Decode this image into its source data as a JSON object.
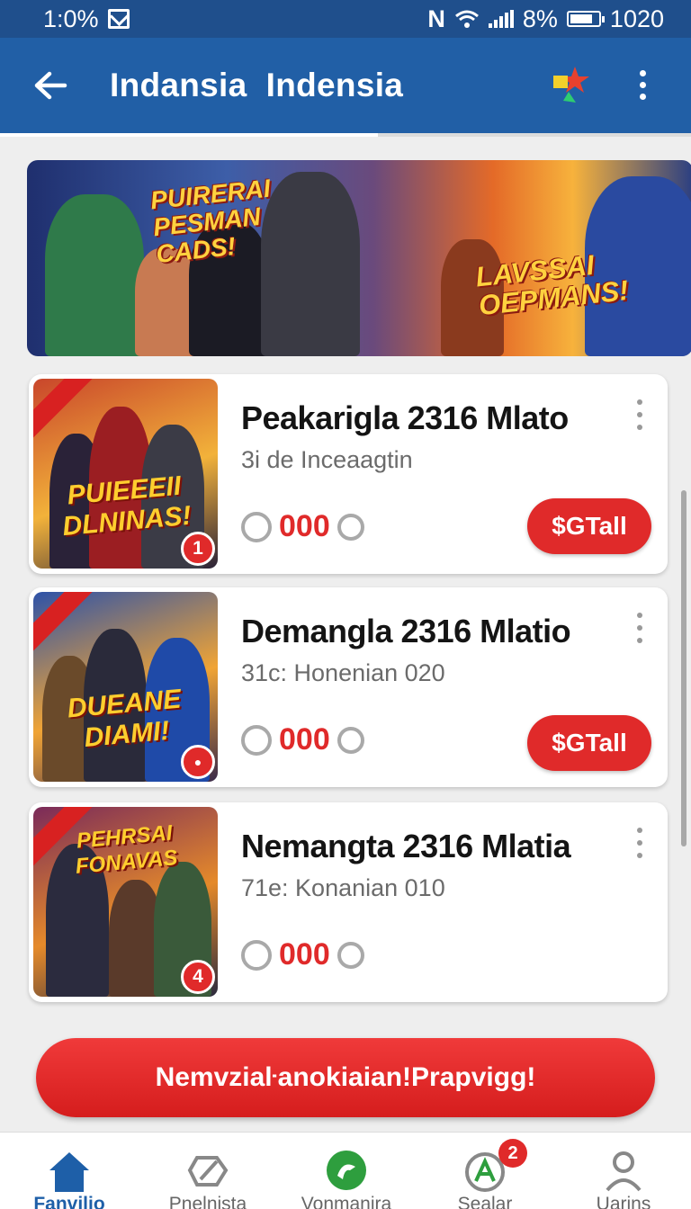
{
  "status_bar": {
    "time": "1:0%",
    "battery": "8%",
    "clock": "1020"
  },
  "app_bar": {
    "title": "Indansia  Indensia"
  },
  "banner": {
    "text_left": "PUIRERAI PESMAN CADS!",
    "text_right": "LAVSSAI OEPMANS!"
  },
  "cards": [
    {
      "thumb_title": "PUIEEEII DLNINAS!",
      "badge": "1",
      "name": "Peakarigla 2316 Mlato",
      "subtitle": "3i de Inceaagtin",
      "stat": "000",
      "action": "$GTall",
      "colors": [
        "#c9462b",
        "#f2b23a",
        "#2a2238"
      ]
    },
    {
      "thumb_title": "DUEANE DIAMI!",
      "badge": "●",
      "name": "Demangla 2316 Mlatio",
      "subtitle": "31c: Honenian 020",
      "stat": "000",
      "action": "$GTall",
      "colors": [
        "#2d52a8",
        "#f0a435",
        "#3a2a4a"
      ]
    },
    {
      "thumb_title": "PEHRSAI FONAVAS",
      "badge": "4",
      "name": "Nemangta 2316 Mlatia",
      "subtitle": "71e: Konanian 010",
      "stat": "000",
      "action": null,
      "colors": [
        "#7a2a5a",
        "#e58a2a",
        "#2b2b3e"
      ]
    }
  ],
  "cta": {
    "label": "Nemvziaŀanokiaian!Prapvigg!"
  },
  "bottom_nav": [
    {
      "label": "Fanvilio",
      "icon": "home-icon",
      "active": true
    },
    {
      "label": "Pnelnista",
      "icon": "swap-icon",
      "active": false
    },
    {
      "label": "Vonmanira",
      "icon": "chat-bubble-icon",
      "active": false
    },
    {
      "label": "Sealar",
      "icon": "search-alert-icon",
      "active": false,
      "badge": "2"
    },
    {
      "label": "Uarins",
      "icon": "user-icon",
      "active": false
    }
  ]
}
